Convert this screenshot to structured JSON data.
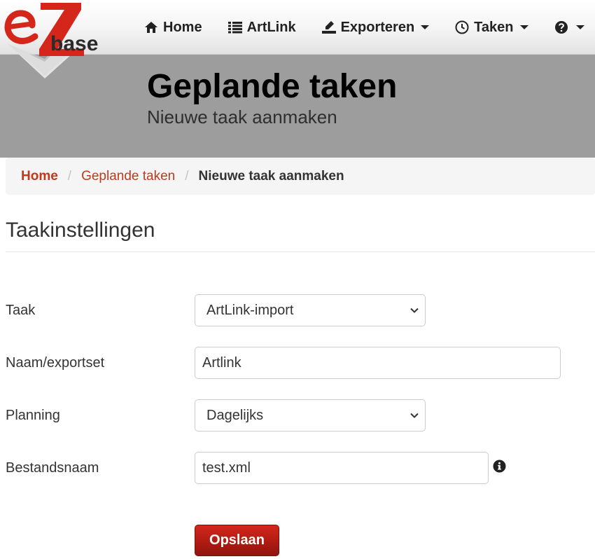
{
  "brand": {
    "logo_text": "base",
    "logo_letters": "eZ",
    "logo_red": "#d5261b"
  },
  "nav": {
    "home": "Home",
    "artlink": "ArtLink",
    "exporteren": "Exporteren",
    "taken": "Taken"
  },
  "header": {
    "title": "Geplande taken",
    "subtitle": "Nieuwe taak aanmaken"
  },
  "breadcrumb": {
    "items": [
      "Home",
      "Geplande taken"
    ],
    "active": "Nieuwe taak aanmaken"
  },
  "section": {
    "title": "Taakinstellingen"
  },
  "form": {
    "taak": {
      "label": "Taak",
      "value": "ArtLink-import"
    },
    "naam": {
      "label": "Naam/exportset",
      "value": "Artlink"
    },
    "planning": {
      "label": "Planning",
      "value": "Dagelijks"
    },
    "bestandsnaam": {
      "label": "Bestandsnaam",
      "value": "test.xml"
    }
  },
  "actions": {
    "save_label": "Opslaan"
  },
  "colors": {
    "accent": "#c0391b",
    "button": "#b01b12",
    "jumbotron": "#9d9d9d"
  }
}
